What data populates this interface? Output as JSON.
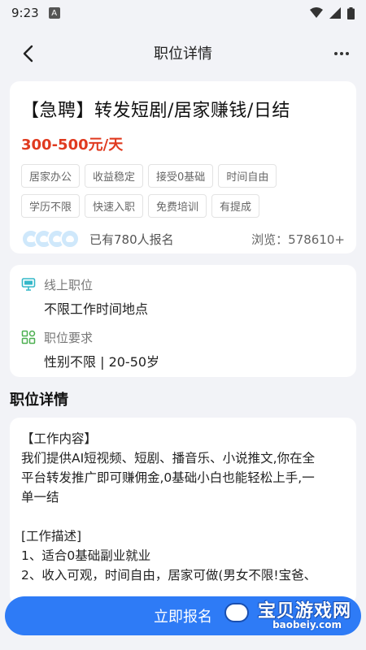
{
  "status_bar": {
    "time": "9:23",
    "notification_glyph": "A"
  },
  "nav": {
    "title": "职位详情"
  },
  "job": {
    "title": "【急聘】转发短剧/居家赚钱/日结",
    "salary": "300-500元/天",
    "tags": [
      "居家办公",
      "收益稳定",
      "接受0基础",
      "时间自由",
      "学历不限",
      "快速入职",
      "免费培训",
      "有提成"
    ],
    "applied_text": "已有780人报名",
    "views_text": "浏览：578610+"
  },
  "info": {
    "mode_label": "线上职位",
    "mode_value": "不限工作时间地点",
    "req_label": "职位要求",
    "req_value": "性别不限 | 20-50岁"
  },
  "section_title": "职位详情",
  "description": {
    "lines": [
      "【工作内容】",
      "我们提供AI短视频、短剧、播音乐、小说推文,你在全",
      "平台转发推广即可赚佣金,0基础小白也能轻松上手,一",
      "单一结",
      "",
      "[工作描述]",
      "1、适合0基础副业就业",
      "2、收入可观，时间自由，居家可做(男女不限!宝爸、"
    ]
  },
  "apply_button": "立即报名",
  "watermark": {
    "title": "宝贝游戏网",
    "url": "baobeiy.com"
  },
  "colors": {
    "accent": "#2e7bf6",
    "salary": "#e03a1f",
    "icon_teal": "#35b8c9"
  }
}
